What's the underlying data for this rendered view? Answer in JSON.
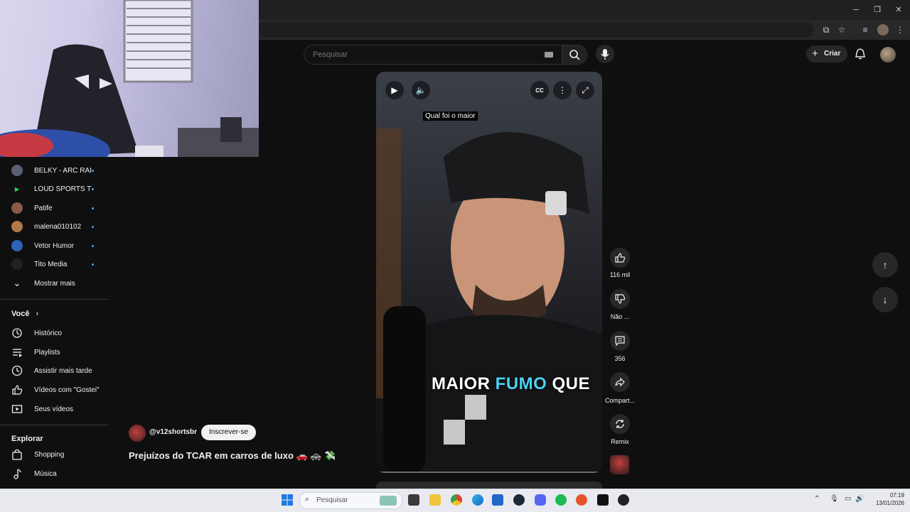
{
  "browser": {
    "window_controls": {
      "minimize": "─",
      "maximize": "❐",
      "close": "✕"
    }
  },
  "youtube": {
    "search": {
      "placeholder": "Pesquisar"
    },
    "create_label": "Criar"
  },
  "sidebar": {
    "subscriptions": [
      {
        "label": "BELKY - ARC RAI...",
        "color": "#5a6072"
      },
      {
        "label": "LOUD SPORTS TV",
        "color": "#111111"
      },
      {
        "label": "Patife",
        "color": "#8a5a48"
      },
      {
        "label": "malena010102",
        "color": "#b07a4a"
      },
      {
        "label": "Vetor Humor",
        "color": "#2f63b8"
      },
      {
        "label": "Tito Media",
        "color": "#222222"
      }
    ],
    "show_more": "Mostrar mais",
    "you_section": "Você",
    "you_items": [
      {
        "label": "Histórico"
      },
      {
        "label": "Playlists"
      },
      {
        "label": "Assistir mais tarde"
      },
      {
        "label": "Vídeos com \"Gostei\""
      },
      {
        "label": "Seus vídeos"
      }
    ],
    "explore_section": "Explorar",
    "explore_items": [
      {
        "label": "Shopping"
      },
      {
        "label": "Música"
      }
    ]
  },
  "short": {
    "top_caption": "Qual foi o maior",
    "subtitle_white_1": "MAIOR",
    "subtitle_accent": "FUMO",
    "subtitle_white_2": "QUE",
    "accent_color": "#49d1f0",
    "channel": "@v12shortsbr",
    "subscribe_label": "Inscrever-se",
    "title": "Prejuízos do TCAR em carros de luxo 🚗 🚓 💸",
    "likes": "116 mil",
    "dislike_label": "Não ...",
    "comments": "356",
    "share_label": "Compart...",
    "remix_label": "Remix"
  },
  "taskbar": {
    "search_placeholder": "Pesquisar",
    "time": "07:19",
    "date": "13/01/2026"
  }
}
